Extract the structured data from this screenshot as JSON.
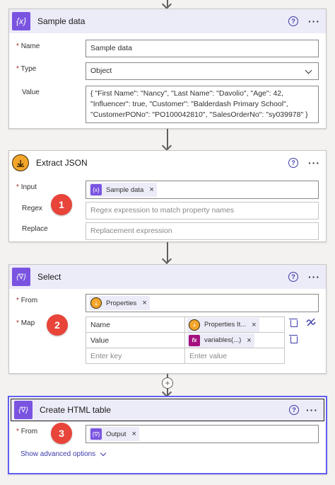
{
  "cards": {
    "sample": {
      "title": "Sample data",
      "icon_label": "{x}",
      "help": "?",
      "more": "···",
      "fields": {
        "name_label": "Name",
        "name_value": "Sample data",
        "type_label": "Type",
        "type_value": "Object",
        "value_label": "Value",
        "value_line1": "{ \"First Name\": \"Nancy\", \"Last Name\": \"Davolio\", \"Age\": 42,",
        "value_line2": "\"Influencer\": true, \"Customer\": \"Balderdash Primary School\",",
        "value_line3": "\"CustomerPONo\": \"PO100042810\",  \"SalesOrderNo\": \"sy039978\" }"
      }
    },
    "extract": {
      "title": "Extract JSON",
      "help": "?",
      "more": "···",
      "fields": {
        "input_label": "Input",
        "input_token": "Sample data",
        "regex_label": "Regex",
        "regex_placeholder": "Regex expression to match property names",
        "replace_label": "Replace",
        "replace_placeholder": "Replacement expression"
      }
    },
    "select": {
      "title": "Select",
      "icon_label": "{∇}",
      "help": "?",
      "more": "···",
      "fields": {
        "from_label": "From",
        "from_token": "Properties",
        "map_label": "Map",
        "map_rows": [
          {
            "key": "Name",
            "value_token": "Properties It..."
          },
          {
            "key": "Value",
            "value_token": "variables(...)"
          }
        ],
        "key_placeholder": "Enter key",
        "value_placeholder": "Enter value"
      }
    },
    "html_table": {
      "title": "Create HTML table",
      "icon_label": "{∇}",
      "help": "?",
      "more": "···",
      "fields": {
        "from_label": "From",
        "from_token": "Output",
        "advanced": "Show advanced options"
      }
    }
  },
  "badges": [
    "1",
    "2",
    "3"
  ],
  "tokens": {
    "fx": "fx",
    "x": "×"
  },
  "required_mark": "*",
  "plus": "+",
  "colors": {
    "accent_purple": "#7a54e0",
    "header_purple": "#ecebf8",
    "badge_red": "#e8443a",
    "link_blue": "#3b3ba8",
    "selected_border": "#605ff1"
  }
}
